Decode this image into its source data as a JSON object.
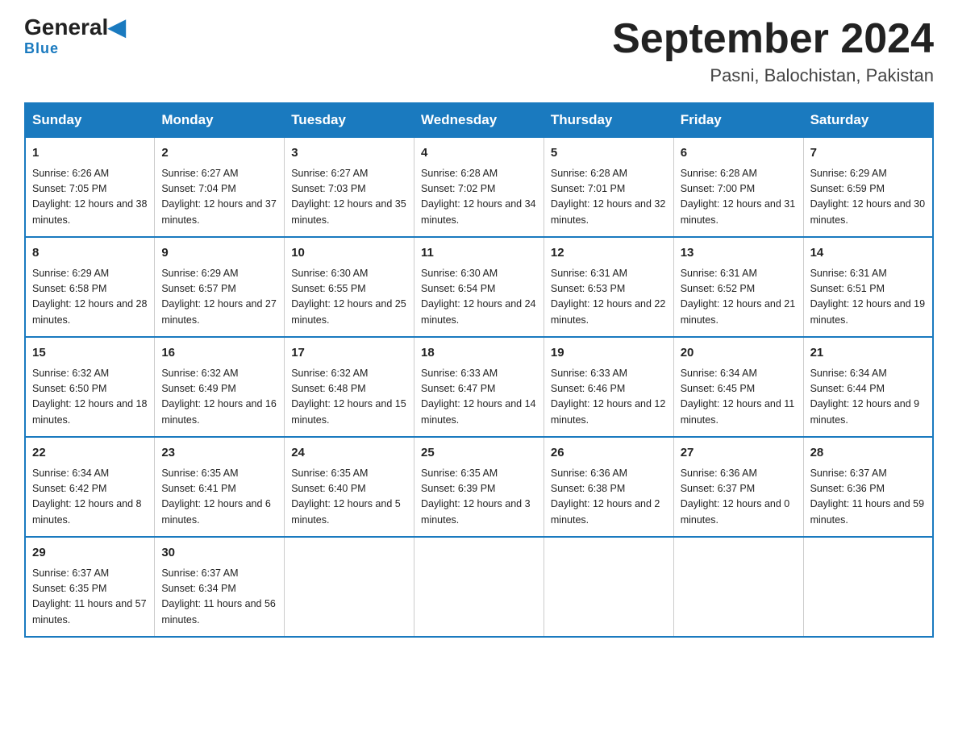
{
  "header": {
    "logo_general": "General",
    "logo_blue": "Blue",
    "title": "September 2024",
    "subtitle": "Pasni, Balochistan, Pakistan"
  },
  "days_of_week": [
    "Sunday",
    "Monday",
    "Tuesday",
    "Wednesday",
    "Thursday",
    "Friday",
    "Saturday"
  ],
  "weeks": [
    [
      {
        "day": "1",
        "sunrise": "6:26 AM",
        "sunset": "7:05 PM",
        "daylight": "12 hours and 38 minutes."
      },
      {
        "day": "2",
        "sunrise": "6:27 AM",
        "sunset": "7:04 PM",
        "daylight": "12 hours and 37 minutes."
      },
      {
        "day": "3",
        "sunrise": "6:27 AM",
        "sunset": "7:03 PM",
        "daylight": "12 hours and 35 minutes."
      },
      {
        "day": "4",
        "sunrise": "6:28 AM",
        "sunset": "7:02 PM",
        "daylight": "12 hours and 34 minutes."
      },
      {
        "day": "5",
        "sunrise": "6:28 AM",
        "sunset": "7:01 PM",
        "daylight": "12 hours and 32 minutes."
      },
      {
        "day": "6",
        "sunrise": "6:28 AM",
        "sunset": "7:00 PM",
        "daylight": "12 hours and 31 minutes."
      },
      {
        "day": "7",
        "sunrise": "6:29 AM",
        "sunset": "6:59 PM",
        "daylight": "12 hours and 30 minutes."
      }
    ],
    [
      {
        "day": "8",
        "sunrise": "6:29 AM",
        "sunset": "6:58 PM",
        "daylight": "12 hours and 28 minutes."
      },
      {
        "day": "9",
        "sunrise": "6:29 AM",
        "sunset": "6:57 PM",
        "daylight": "12 hours and 27 minutes."
      },
      {
        "day": "10",
        "sunrise": "6:30 AM",
        "sunset": "6:55 PM",
        "daylight": "12 hours and 25 minutes."
      },
      {
        "day": "11",
        "sunrise": "6:30 AM",
        "sunset": "6:54 PM",
        "daylight": "12 hours and 24 minutes."
      },
      {
        "day": "12",
        "sunrise": "6:31 AM",
        "sunset": "6:53 PM",
        "daylight": "12 hours and 22 minutes."
      },
      {
        "day": "13",
        "sunrise": "6:31 AM",
        "sunset": "6:52 PM",
        "daylight": "12 hours and 21 minutes."
      },
      {
        "day": "14",
        "sunrise": "6:31 AM",
        "sunset": "6:51 PM",
        "daylight": "12 hours and 19 minutes."
      }
    ],
    [
      {
        "day": "15",
        "sunrise": "6:32 AM",
        "sunset": "6:50 PM",
        "daylight": "12 hours and 18 minutes."
      },
      {
        "day": "16",
        "sunrise": "6:32 AM",
        "sunset": "6:49 PM",
        "daylight": "12 hours and 16 minutes."
      },
      {
        "day": "17",
        "sunrise": "6:32 AM",
        "sunset": "6:48 PM",
        "daylight": "12 hours and 15 minutes."
      },
      {
        "day": "18",
        "sunrise": "6:33 AM",
        "sunset": "6:47 PM",
        "daylight": "12 hours and 14 minutes."
      },
      {
        "day": "19",
        "sunrise": "6:33 AM",
        "sunset": "6:46 PM",
        "daylight": "12 hours and 12 minutes."
      },
      {
        "day": "20",
        "sunrise": "6:34 AM",
        "sunset": "6:45 PM",
        "daylight": "12 hours and 11 minutes."
      },
      {
        "day": "21",
        "sunrise": "6:34 AM",
        "sunset": "6:44 PM",
        "daylight": "12 hours and 9 minutes."
      }
    ],
    [
      {
        "day": "22",
        "sunrise": "6:34 AM",
        "sunset": "6:42 PM",
        "daylight": "12 hours and 8 minutes."
      },
      {
        "day": "23",
        "sunrise": "6:35 AM",
        "sunset": "6:41 PM",
        "daylight": "12 hours and 6 minutes."
      },
      {
        "day": "24",
        "sunrise": "6:35 AM",
        "sunset": "6:40 PM",
        "daylight": "12 hours and 5 minutes."
      },
      {
        "day": "25",
        "sunrise": "6:35 AM",
        "sunset": "6:39 PM",
        "daylight": "12 hours and 3 minutes."
      },
      {
        "day": "26",
        "sunrise": "6:36 AM",
        "sunset": "6:38 PM",
        "daylight": "12 hours and 2 minutes."
      },
      {
        "day": "27",
        "sunrise": "6:36 AM",
        "sunset": "6:37 PM",
        "daylight": "12 hours and 0 minutes."
      },
      {
        "day": "28",
        "sunrise": "6:37 AM",
        "sunset": "6:36 PM",
        "daylight": "11 hours and 59 minutes."
      }
    ],
    [
      {
        "day": "29",
        "sunrise": "6:37 AM",
        "sunset": "6:35 PM",
        "daylight": "11 hours and 57 minutes."
      },
      {
        "day": "30",
        "sunrise": "6:37 AM",
        "sunset": "6:34 PM",
        "daylight": "11 hours and 56 minutes."
      },
      null,
      null,
      null,
      null,
      null
    ]
  ]
}
